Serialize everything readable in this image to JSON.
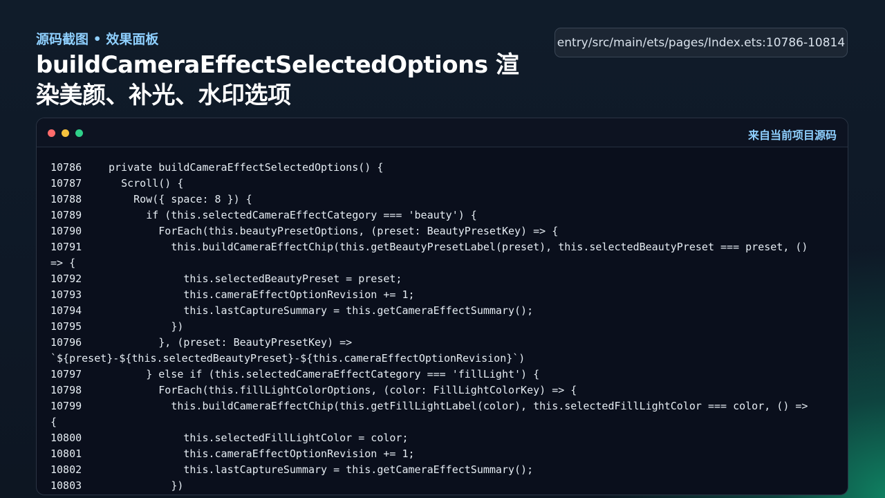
{
  "header": {
    "kicker": "源码截图 • 效果面板",
    "title": "buildCameraEffectSelectedOptions 渲染美颜、补光、水印选项",
    "file_path": "entry/src/main/ets/pages/Index.ets:10786-10814"
  },
  "window": {
    "source_label": "来自当前项目源码",
    "controls": [
      "close",
      "minimize",
      "maximize"
    ]
  },
  "code_lines": [
    {
      "n": "10786",
      "t": "private buildCameraEffectSelectedOptions() {"
    },
    {
      "n": "10787",
      "t": "  Scroll() {"
    },
    {
      "n": "10788",
      "t": "    Row({ space: 8 }) {"
    },
    {
      "n": "10789",
      "t": "      if (this.selectedCameraEffectCategory === 'beauty') {"
    },
    {
      "n": "10790",
      "t": "        ForEach(this.beautyPresetOptions, (preset: BeautyPresetKey) => {"
    },
    {
      "n": "10791",
      "t": "          this.buildCameraEffectChip(this.getBeautyPresetLabel(preset), this.selectedBeautyPreset === preset, ()",
      "w": "=> {"
    },
    {
      "n": "10792",
      "t": "            this.selectedBeautyPreset = preset;"
    },
    {
      "n": "10793",
      "t": "            this.cameraEffectOptionRevision += 1;"
    },
    {
      "n": "10794",
      "t": "            this.lastCaptureSummary = this.getCameraEffectSummary();"
    },
    {
      "n": "10795",
      "t": "          })"
    },
    {
      "n": "10796",
      "t": "        }, (preset: BeautyPresetKey) =>",
      "w": "`${preset}-${this.selectedBeautyPreset}-${this.cameraEffectOptionRevision}`)"
    },
    {
      "n": "10797",
      "t": "      } else if (this.selectedCameraEffectCategory === 'fillLight') {"
    },
    {
      "n": "10798",
      "t": "        ForEach(this.fillLightColorOptions, (color: FillLightColorKey) => {"
    },
    {
      "n": "10799",
      "t": "          this.buildCameraEffectChip(this.getFillLightLabel(color), this.selectedFillLightColor === color, () =>",
      "w": "{"
    },
    {
      "n": "10800",
      "t": "            this.selectedFillLightColor = color;"
    },
    {
      "n": "10801",
      "t": "            this.cameraEffectOptionRevision += 1;"
    },
    {
      "n": "10802",
      "t": "            this.lastCaptureSummary = this.getCameraEffectSummary();"
    },
    {
      "n": "10803",
      "t": "          })"
    }
  ]
}
